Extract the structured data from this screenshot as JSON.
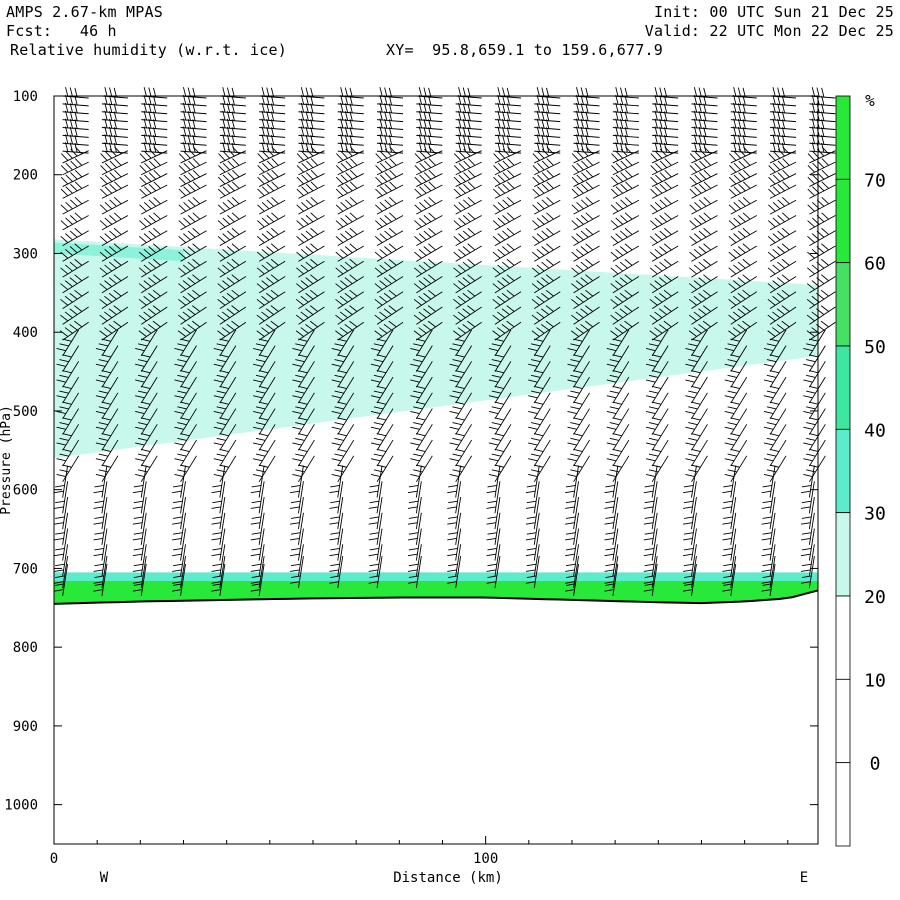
{
  "header": {
    "model": "AMPS 2.67-km MPAS",
    "forecast": "Fcst:   46 h",
    "field": "Relative humidity (w.r.t. ice)",
    "section": "XY=  95.8,659.1 to 159.6,677.9",
    "init": "Init: 00 UTC Sun 21 Dec 25",
    "valid": "Valid: 22 UTC Mon 22 Dec 25"
  },
  "chart_data": {
    "type": "heatmap",
    "title": "Relative humidity (w.r.t. ice)",
    "xlabel": "Distance (km)",
    "ylabel": "Pressure (hPa)",
    "xlim": [
      0,
      177
    ],
    "ylim": [
      1050,
      100
    ],
    "x_ticks": [
      0,
      100
    ],
    "x_tick_labels": [
      "0",
      "100"
    ],
    "y_ticks": [
      100,
      200,
      300,
      400,
      500,
      600,
      700,
      800,
      900,
      1000
    ],
    "y_tick_labels": [
      "100",
      "200",
      "300",
      "400",
      "500",
      "600",
      "700",
      "800",
      "900",
      "1000"
    ],
    "x_end_labels": [
      "W",
      "E"
    ],
    "colorbar": {
      "unit": "%",
      "levels": [
        0,
        10,
        20,
        30,
        40,
        50,
        60,
        70
      ],
      "level_labels": [
        "0",
        "10",
        "20",
        "30",
        "40",
        "50",
        "60",
        "70"
      ],
      "colors": [
        "#ffffff",
        "#ffffff",
        "#ffffff",
        "#c8f8ec",
        "#5ceccc",
        "#3ee6a0",
        "#46e064",
        "#28e83a"
      ]
    },
    "terrain_surface": {
      "distance_km": [
        0,
        20,
        40,
        60,
        80,
        100,
        120,
        140,
        150,
        160,
        165,
        170,
        177
      ],
      "pressure_hpa": [
        745,
        742,
        740,
        738,
        737,
        737,
        740,
        743,
        744,
        742,
        740,
        738,
        728
      ]
    },
    "moist_layers": [
      {
        "name": "upper",
        "rh_percent": 32,
        "top_west": 282,
        "bottom_west": 560,
        "top_east": 340,
        "bottom_east": 430
      },
      {
        "name": "boundary",
        "rh_percent": 70,
        "top_hpa": 710,
        "bottom_hpa": "surface"
      }
    ],
    "wind_barbs": {
      "columns": 20,
      "levels_hpa": [
        100,
        110,
        120,
        130,
        140,
        150,
        160,
        170,
        185,
        200,
        215,
        230,
        250,
        270,
        290,
        310,
        330,
        350,
        370,
        390,
        410,
        430,
        450,
        470,
        490,
        510,
        530,
        550,
        570,
        590,
        610,
        630,
        650,
        670,
        690,
        710,
        725,
        735
      ]
    }
  }
}
